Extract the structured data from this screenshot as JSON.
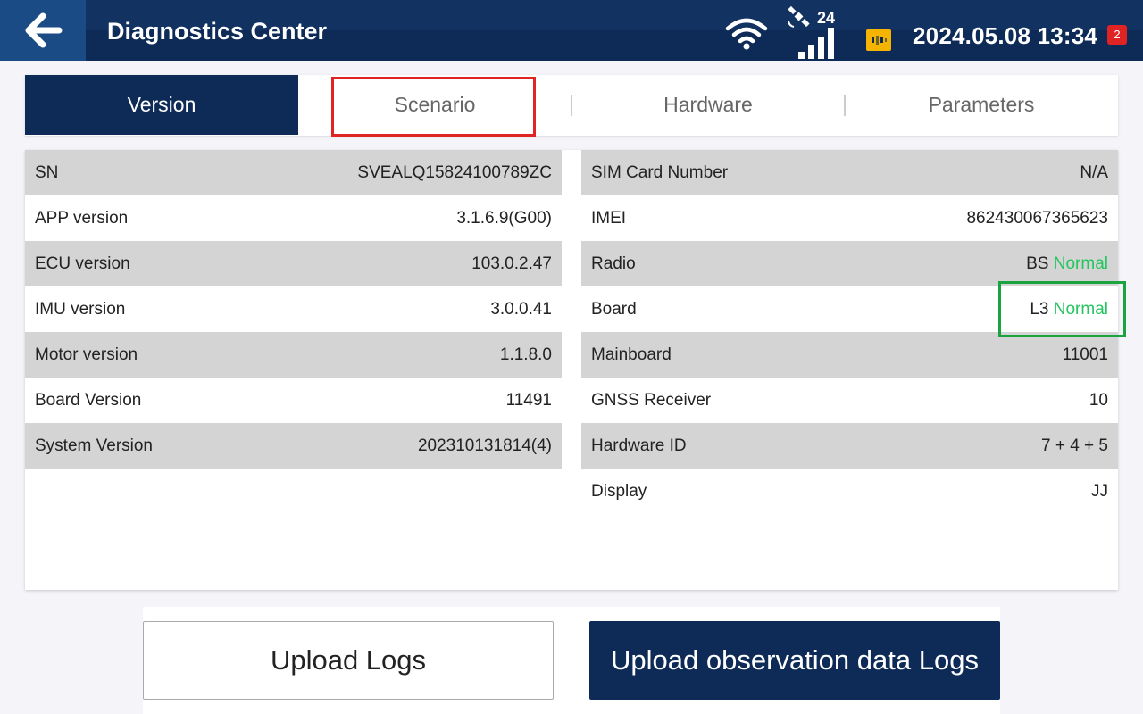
{
  "header": {
    "title": "Diagnostics Center",
    "satellite_count": "24",
    "datetime": "2024.05.08 13:34",
    "notification_count": "2"
  },
  "tabs": [
    {
      "label": "Version",
      "active": true
    },
    {
      "label": "Scenario",
      "active": false
    },
    {
      "label": "Hardware",
      "active": false
    },
    {
      "label": "Parameters",
      "active": false
    }
  ],
  "version_info": {
    "left": [
      {
        "label": "SN",
        "value": "SVEALQ15824100789ZC"
      },
      {
        "label": "APP version",
        "value": "3.1.6.9(G00)"
      },
      {
        "label": "ECU version",
        "value": "103.0.2.47"
      },
      {
        "label": "IMU version",
        "value": "3.0.0.41"
      },
      {
        "label": "Motor version",
        "value": "1.1.8.0"
      },
      {
        "label": "Board Version",
        "value": "11491"
      },
      {
        "label": "System Version",
        "value": "202310131814(4)"
      }
    ],
    "right": [
      {
        "label": "SIM Card Number",
        "value": "N/A"
      },
      {
        "label": "IMEI",
        "value": "862430067365623"
      },
      {
        "label": "Radio",
        "value": "BS",
        "status": "Normal"
      },
      {
        "label": "Board",
        "value": "L3",
        "status": "Normal"
      },
      {
        "label": "Mainboard",
        "value": "11001"
      },
      {
        "label": "GNSS Receiver",
        "value": "10"
      },
      {
        "label": "Hardware ID",
        "value": "7 + 4 + 5"
      },
      {
        "label": "Display",
        "value": "JJ"
      }
    ]
  },
  "buttons": {
    "upload_logs": "Upload Logs",
    "upload_observation": "Upload observation data Logs"
  },
  "colors": {
    "primary": "#0e2b57",
    "status_ok": "#22c55e",
    "highlight_red": "#e02424",
    "highlight_green": "#1aa33e"
  }
}
